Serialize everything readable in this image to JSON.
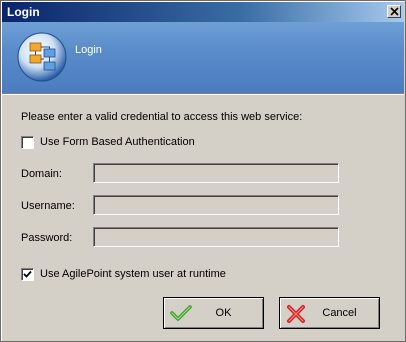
{
  "window": {
    "title": "Login",
    "close_icon": "close-icon"
  },
  "banner": {
    "title": "Login",
    "icon": "network-diagram-icon"
  },
  "form": {
    "prompt": "Please enter a valid credential to access this web service:",
    "form_auth": {
      "label": "Use Form Based Authentication",
      "checked": false
    },
    "domain": {
      "label": "Domain:",
      "value": ""
    },
    "username": {
      "label": "Username:",
      "value": ""
    },
    "password": {
      "label": "Password:",
      "value": ""
    },
    "system_user": {
      "label": "Use AgilePoint system user at runtime",
      "checked": true
    }
  },
  "buttons": {
    "ok_label": "OK",
    "ok_icon": "checkmark-icon",
    "ok_icon_color": "#3a9a2a",
    "cancel_label": "Cancel",
    "cancel_icon": "x-icon",
    "cancel_icon_color": "#d42020"
  }
}
